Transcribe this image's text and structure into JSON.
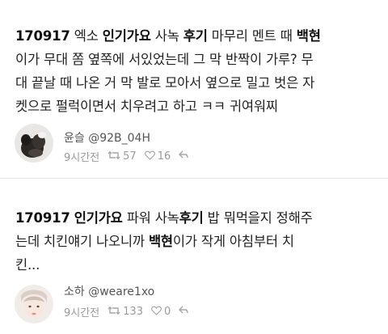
{
  "tweets": [
    {
      "lines": [
        [
          {
            "t": "170917",
            "b": true
          },
          {
            "t": " 엑소 ",
            "b": false
          },
          {
            "t": "인기가요",
            "b": true
          },
          {
            "t": " 사녹 ",
            "b": false
          },
          {
            "t": "후기",
            "b": true
          },
          {
            "t": " 마무리 멘트 때 ",
            "b": false
          },
          {
            "t": "백현",
            "b": true
          }
        ],
        [
          {
            "t": "이가 무대 쫌 옆쪽에 서있었는데 그 막 반짝이 가루? 무",
            "b": false
          }
        ],
        [
          {
            "t": "대 끝날 때 나온 거 막 발로 모아서 옆으로 밀고 벗은 자",
            "b": false
          }
        ],
        [
          {
            "t": "켓으로 펄럭이면서 치우려고 하고 ㅋㅋ 귀여워찌",
            "b": false
          }
        ]
      ],
      "author": "윤슬 @92B_04H",
      "time": "9시간전",
      "retweets": "57",
      "likes": "16"
    },
    {
      "lines": [
        [
          {
            "t": "170917",
            "b": true
          },
          {
            "t": " ",
            "b": false
          },
          {
            "t": "인기가요",
            "b": true
          },
          {
            "t": " 파워 사녹",
            "b": false
          },
          {
            "t": "후기",
            "b": true
          },
          {
            "t": " 밥 뭐먹을지 정해주",
            "b": false
          }
        ],
        [
          {
            "t": "는데 치킨얘기 나오니까 ",
            "b": false
          },
          {
            "t": "백현",
            "b": true
          },
          {
            "t": "이가 작게 아침부터 치",
            "b": false
          }
        ],
        [
          {
            "t": "킨...",
            "b": false
          }
        ]
      ],
      "author": "소하 @weare1xo",
      "time": "9시간전",
      "retweets": "133",
      "likes": "0"
    }
  ],
  "icons": {
    "retweet": "retweet-icon",
    "like": "heart-icon",
    "reply": "reply-icon"
  }
}
